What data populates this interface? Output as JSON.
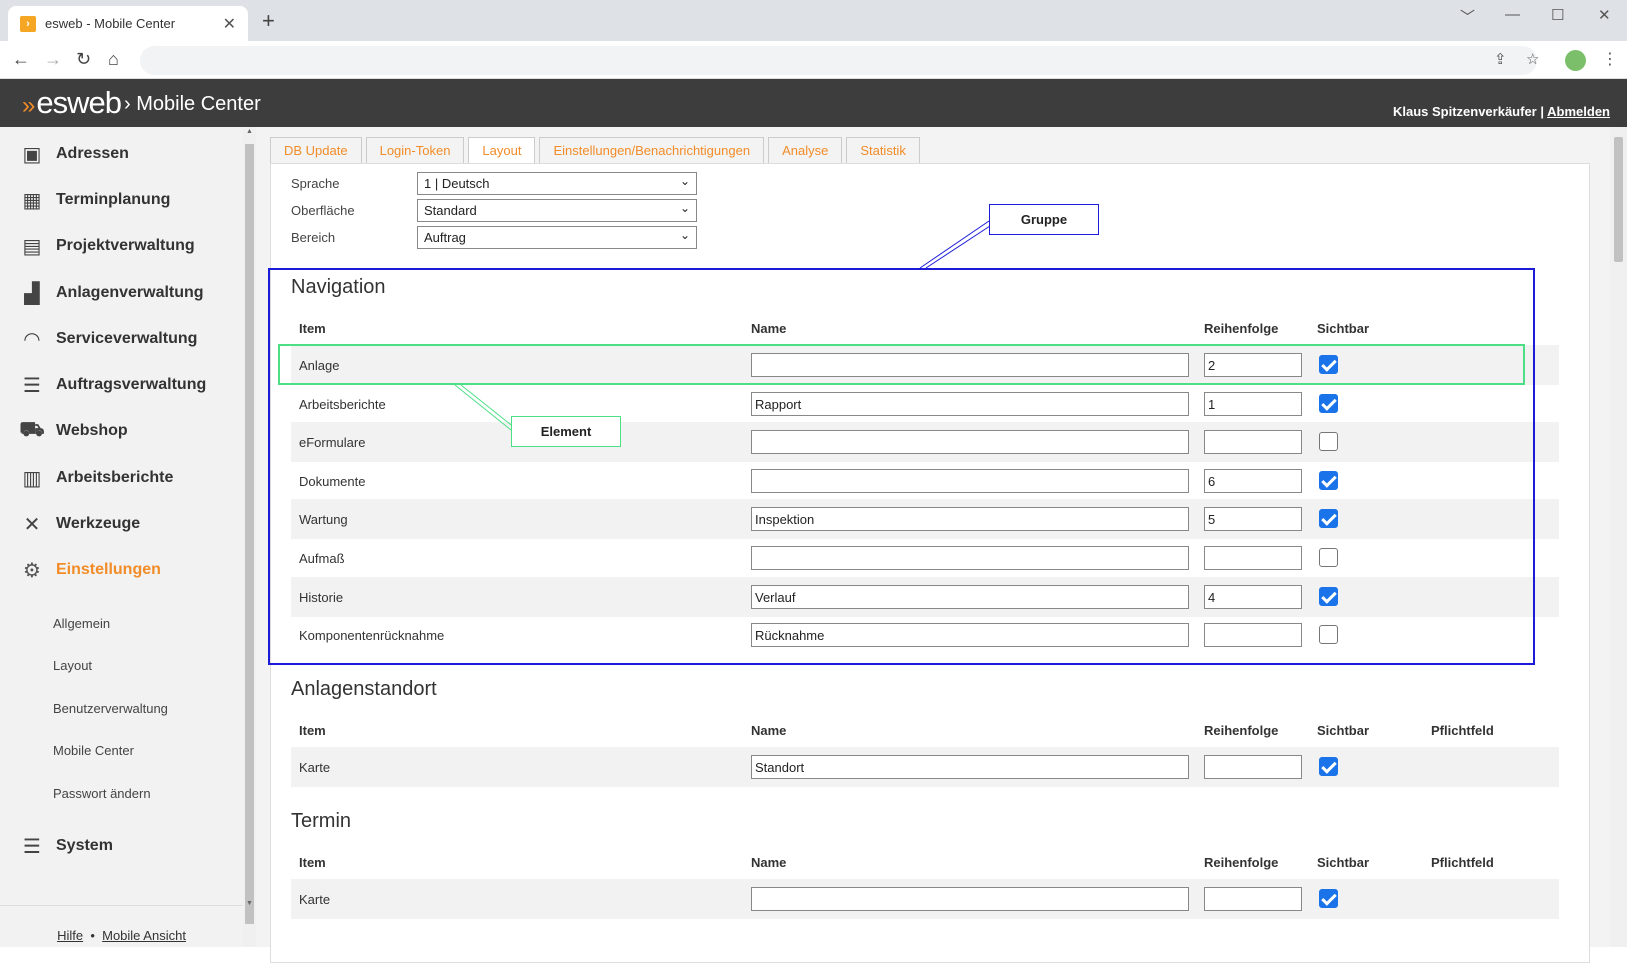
{
  "browser": {
    "tab_title": "esweb - Mobile Center",
    "favicon_glyph": "›",
    "new_tab": "+",
    "window_controls": [
      "﹀",
      "—",
      "☐",
      "✕"
    ]
  },
  "header": {
    "logo_text": "esweb",
    "logo_separator": "›",
    "title": "Mobile Center",
    "user_name": "Klaus Spitzenverkäufer",
    "separator": "|",
    "logout_label": "Abmelden"
  },
  "sidebar": {
    "items": [
      {
        "label": "Adressen",
        "icon": "address-book-icon"
      },
      {
        "label": "Terminplanung",
        "icon": "calendar-icon"
      },
      {
        "label": "Projektverwaltung",
        "icon": "gantt-icon"
      },
      {
        "label": "Anlagenverwaltung",
        "icon": "factory-icon"
      },
      {
        "label": "Serviceverwaltung",
        "icon": "headset-icon"
      },
      {
        "label": "Auftragsverwaltung",
        "icon": "list-icon"
      },
      {
        "label": "Webshop",
        "icon": "cart-icon"
      },
      {
        "label": "Arbeitsberichte",
        "icon": "clipboard-icon"
      },
      {
        "label": "Werkzeuge",
        "icon": "tools-icon"
      },
      {
        "label": "Einstellungen",
        "icon": "gears-icon",
        "active": true
      }
    ],
    "sub_items": [
      "Allgemein",
      "Layout",
      "Benutzerverwaltung",
      "Mobile Center",
      "Passwort ändern"
    ],
    "system_label": "System",
    "footer_help": "Hilfe",
    "footer_sep": "•",
    "footer_mobile": "Mobile Ansicht",
    "accent": "#f28c28"
  },
  "tabs": [
    "DB Update",
    "Login-Token",
    "Layout",
    "Einstellungen/Benachrichtigungen",
    "Analyse",
    "Statistik"
  ],
  "active_tab": "Layout",
  "filters": {
    "sprache_label": "Sprache",
    "sprache_value": "1 | Deutsch",
    "oberflaeche_label": "Oberfläche",
    "oberflaeche_value": "Standard",
    "bereich_label": "Bereich",
    "bereich_value": "Auftrag"
  },
  "columns": {
    "item": "Item",
    "name": "Name",
    "order": "Reihenfolge",
    "visible": "Sichtbar",
    "required": "Pflichtfeld"
  },
  "sections": [
    {
      "title": "Navigation",
      "rows": [
        {
          "item": "Anlage",
          "name": "",
          "order": "2",
          "visible": true
        },
        {
          "item": "Arbeitsberichte",
          "name": "Rapport",
          "order": "1",
          "visible": true
        },
        {
          "item": "eFormulare",
          "name": "",
          "order": "",
          "visible": false
        },
        {
          "item": "Dokumente",
          "name": "",
          "order": "6",
          "visible": true
        },
        {
          "item": "Wartung",
          "name": "Inspektion",
          "order": "5",
          "visible": true
        },
        {
          "item": "Aufmaß",
          "name": "",
          "order": "",
          "visible": false
        },
        {
          "item": "Historie",
          "name": "Verlauf",
          "order": "4",
          "visible": true
        },
        {
          "item": "Komponentenrücknahme",
          "name": "Rücknahme",
          "order": "",
          "visible": false
        }
      ]
    },
    {
      "title": "Anlagenstandort",
      "rows": [
        {
          "item": "Karte",
          "name": "Standort",
          "order": "",
          "visible": true
        }
      ]
    },
    {
      "title": "Termin",
      "rows": [
        {
          "item": "Karte",
          "name": "",
          "order": "",
          "visible": true
        }
      ]
    }
  ],
  "annotations": {
    "group_label": "Gruppe",
    "element_label": "Element",
    "group_color": "#1c1cd8",
    "element_color": "#4ddf86"
  }
}
